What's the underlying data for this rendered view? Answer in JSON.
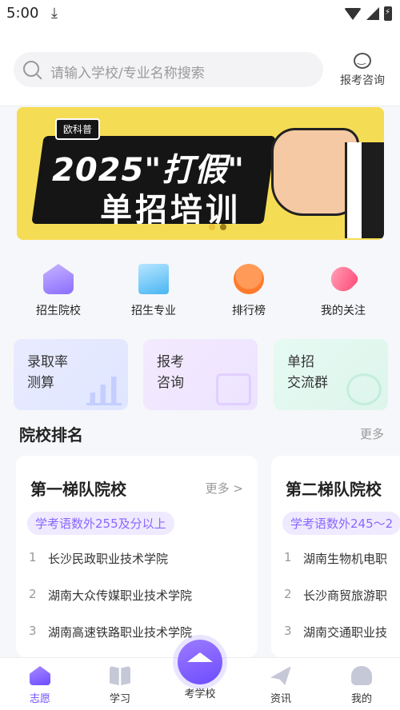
{
  "status_bar": {
    "time": "5:00",
    "download_icon": "download-icon",
    "icons": [
      "wifi-icon",
      "signal-icon",
      "battery-charging-icon"
    ]
  },
  "search": {
    "placeholder": "请输入学校/专业名称搜索",
    "consult_label": "报考咨询",
    "consult_icon": "chat-bubble-icon"
  },
  "banner": {
    "tag": "欧科普",
    "line1": "2025\"打假\"",
    "line2": "单招培训",
    "background": "#f5dc55",
    "dots": 2,
    "active_dot": 1
  },
  "quick_nav": [
    {
      "label": "招生院校",
      "icon": "school-icon"
    },
    {
      "label": "招生专业",
      "icon": "book-icon"
    },
    {
      "label": "排行榜",
      "icon": "medal-icon"
    },
    {
      "label": "我的关注",
      "icon": "heart-icon"
    }
  ],
  "tool_cards": [
    {
      "line1": "录取率",
      "line2": "测算",
      "icon": "chart-icon"
    },
    {
      "line1": "报考",
      "line2": "咨询",
      "icon": "question-icon"
    },
    {
      "line1": "单招",
      "line2": "交流群",
      "icon": "chat-icon"
    }
  ],
  "ranking": {
    "title": "院校排名",
    "more": "更多",
    "tiers": [
      {
        "title": "第一梯队院校",
        "more": "更多 >",
        "tag": "学考语数外255及分以上",
        "schools": [
          {
            "rank": "1",
            "name": "长沙民政职业技术学院"
          },
          {
            "rank": "2",
            "name": "湖南大众传媒职业技术学院"
          },
          {
            "rank": "3",
            "name": "湖南高速铁路职业技术学院"
          }
        ]
      },
      {
        "title": "第二梯队院校",
        "tag": "学考语数外245～2",
        "schools": [
          {
            "rank": "1",
            "name": "湖南生物机电职"
          },
          {
            "rank": "2",
            "name": "长沙商贸旅游职"
          },
          {
            "rank": "3",
            "name": "湖南交通职业技"
          }
        ]
      }
    ]
  },
  "tabbar": [
    {
      "label": "志愿",
      "icon": "volunteer-icon",
      "active": true
    },
    {
      "label": "学习",
      "icon": "study-icon"
    },
    {
      "label": "考学校",
      "icon": "graduation-cap-icon",
      "center": true
    },
    {
      "label": "资讯",
      "icon": "news-icon"
    },
    {
      "label": "我的",
      "icon": "profile-icon"
    }
  ],
  "colors": {
    "accent": "#6d4cff",
    "tag_bg": "#efeaff",
    "page_bg": "#f6f7fa"
  }
}
